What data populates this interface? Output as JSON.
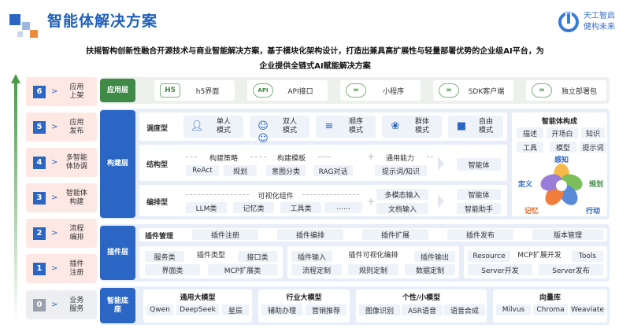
{
  "header": {
    "title": "智能体解决方案",
    "logo_line1": "天工智启",
    "logo_line2": "健构未来",
    "subtitle_line1": "扶摇智构创新性融合开源技术与商业智能解决方案，基于模块化架构设计，打造出兼具高扩展性与轻量部署优势的企业级AI平台，为",
    "subtitle_line2": "企业提供全链式AI赋能解决方案"
  },
  "steps": [
    {
      "num": "6",
      "arrow": ">",
      "label": "应用\n上架"
    },
    {
      "num": "5",
      "arrow": ">",
      "label": "应用\n发布"
    },
    {
      "num": "4",
      "arrow": ">",
      "label": "多智能\n体协调"
    },
    {
      "num": "3",
      "arrow": ">",
      "label": "智能体\n构建"
    },
    {
      "num": "2",
      "arrow": ">",
      "label": "流程\n编排"
    },
    {
      "num": "1",
      "arrow": ">",
      "label": "插件\n注册"
    },
    {
      "num": "0",
      "arrow": ">",
      "label": "业务\n服务"
    }
  ],
  "layers": {
    "app": "应用层",
    "build": "构建层",
    "plugin": "插件层",
    "base": "智能底\n座"
  },
  "app_layer": [
    {
      "icon": "H5",
      "label": "h5界面"
    },
    {
      "icon": "API",
      "label": "API接口"
    },
    {
      "icon": "∞",
      "label": "小程序"
    },
    {
      "icon": "∞",
      "label": "SDK客户端"
    },
    {
      "icon": "∞",
      "label": "独立部署包"
    }
  ],
  "build_layer": {
    "mode_label": "调度型",
    "modes": [
      {
        "icon": "person",
        "label": "单人\n模式"
      },
      {
        "icon": "people",
        "label": "双人\n模式"
      },
      {
        "icon": "list",
        "label": "顺序\n模式"
      },
      {
        "icon": "group",
        "label": "群体\n模式"
      },
      {
        "icon": "free",
        "label": "自由\n模式"
      }
    ],
    "struct_label": "结构型",
    "struct_headers": [
      "构建策略",
      "构建模板",
      "通用能力"
    ],
    "struct_chips": [
      "ReAct",
      "规划",
      "意图分类",
      "RAG对话",
      "提示词/知识"
    ],
    "struct_out": "智能体",
    "orch_label": "编排型",
    "orch_header": "可视化组件",
    "orch_chips": [
      "LLM类",
      "记忆类",
      "工具类",
      "......"
    ],
    "orch_mid": [
      "多模态输入",
      "文档输入"
    ],
    "orch_out": [
      "智能体",
      "智能助手"
    ],
    "comp_title": "智能体构成",
    "comp_chips": [
      "描述",
      "开场白",
      "知识",
      "工具",
      "模型",
      "提示词"
    ],
    "petals": {
      "perceive": "感知",
      "define": "定义",
      "plan": "规划",
      "memory": "记忆",
      "act": "行动"
    }
  },
  "plugin_layer": {
    "mgmt_label": "插件管理",
    "mgmt_chips": [
      "插件注册",
      "插件编排",
      "插件扩展",
      "插件发布",
      "版本管理"
    ],
    "group1": {
      "header": "插件类型",
      "chips": [
        "服务类",
        "接口类",
        "界面类",
        "MCP扩展类"
      ]
    },
    "group2": {
      "header": "插件可视化编排",
      "chips": [
        "插件输入",
        "插件输出",
        "流程定制",
        "规则定制",
        "数据定制"
      ]
    },
    "group3": {
      "header": "MCP扩展开发",
      "chips": [
        "Resource",
        "Tools",
        "Server开发",
        "Server发布"
      ]
    }
  },
  "base_layer": [
    {
      "header": "通用大模型",
      "chips": [
        "Qwen",
        "DeepSeek",
        "星辰"
      ]
    },
    {
      "header": "行业大模型",
      "chips": [
        "辅助办理",
        "营销推荐"
      ]
    },
    {
      "header": "个性/小模型",
      "chips": [
        "图像识别",
        "ASR语音",
        "语音合成"
      ]
    },
    {
      "header": "向量库",
      "chips": [
        "Milvus",
        "Chroma",
        "Weaviate"
      ]
    }
  ],
  "colors": {
    "title_blue": "#1f5fb8",
    "app_green": "#3f8a46",
    "layer_blue": "#2b66c4",
    "step_bg": "#fde8e4"
  }
}
